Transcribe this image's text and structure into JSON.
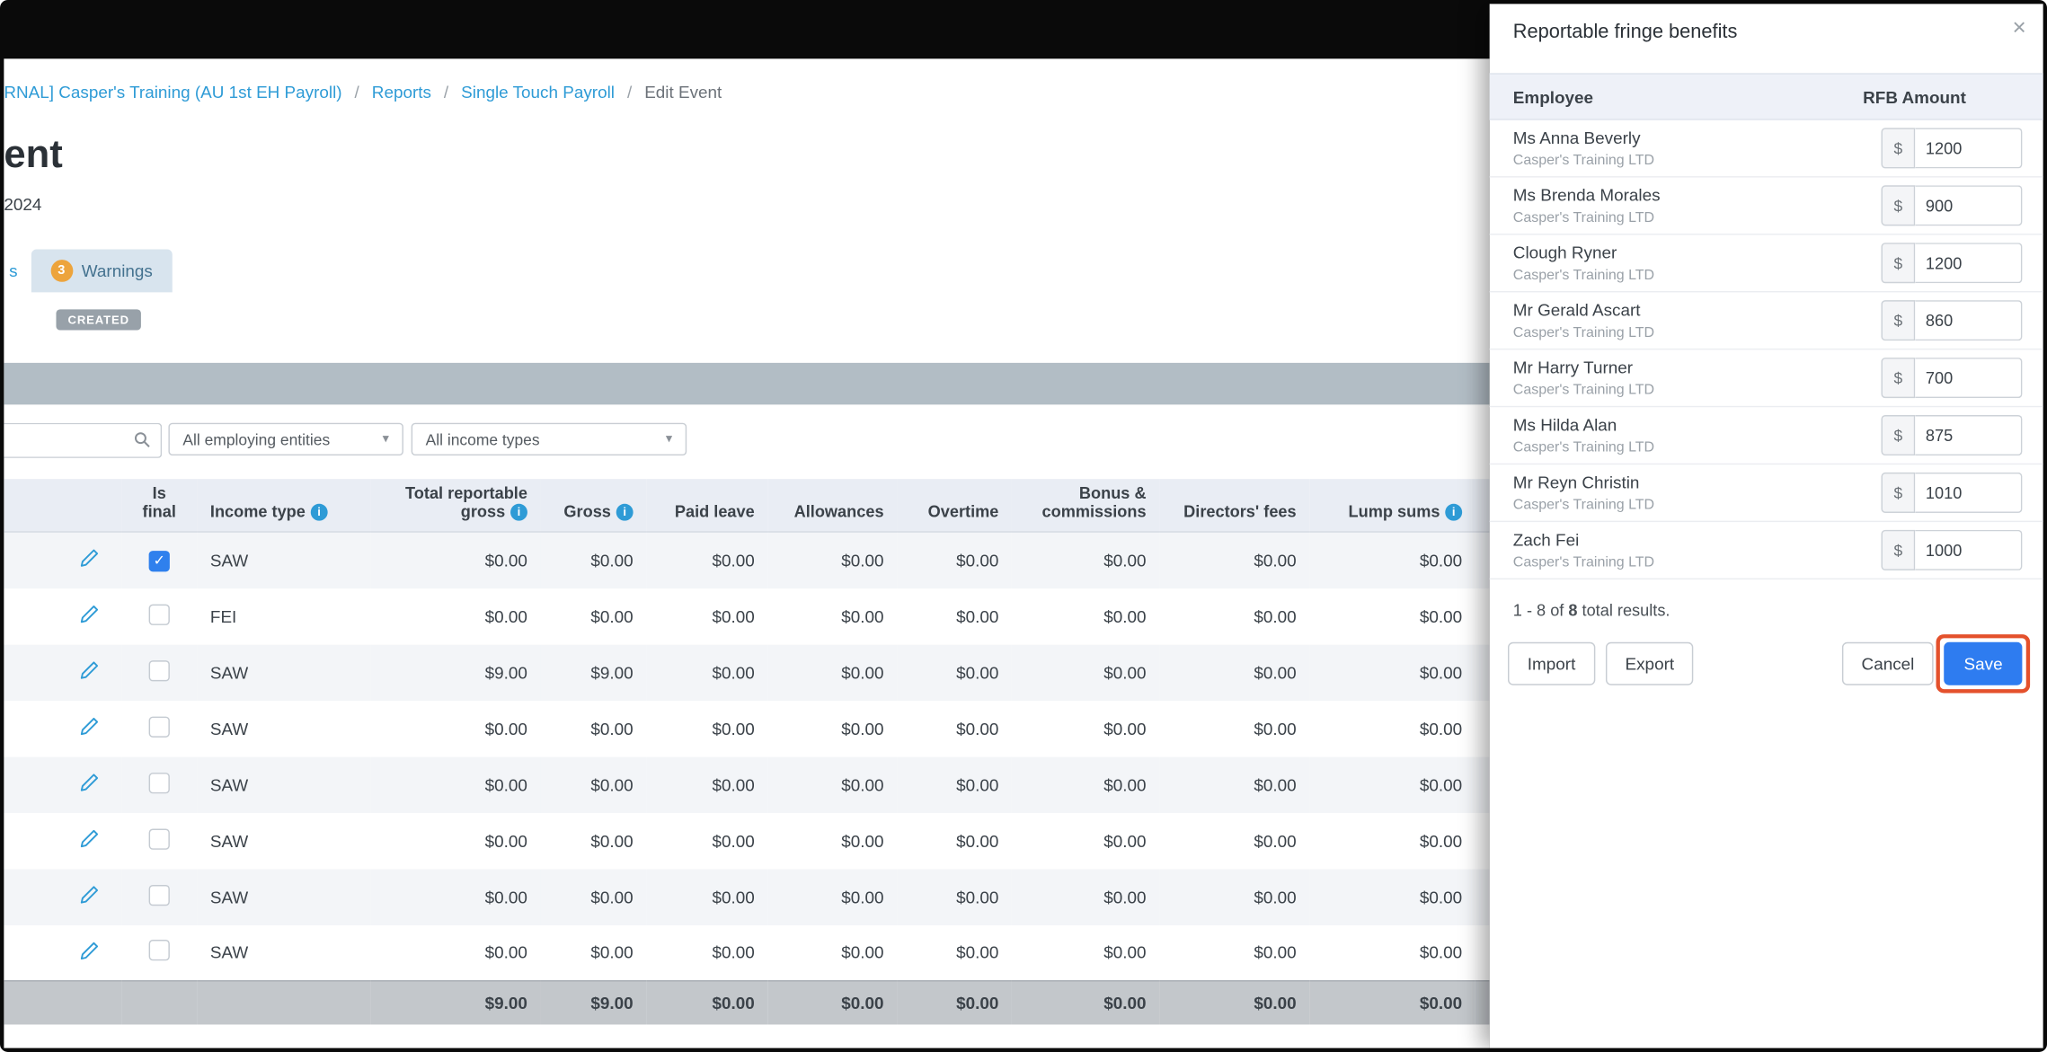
{
  "breadcrumb": {
    "items": [
      {
        "label": "RNAL] Casper's Training (AU 1st EH Payroll)"
      },
      {
        "label": "Reports"
      },
      {
        "label": "Single Touch Payroll"
      },
      {
        "label": "Edit Event"
      }
    ],
    "separator": "/"
  },
  "page": {
    "title_partial": "ent",
    "subtitle": "2024",
    "status_badge": "CREATED",
    "tabs": {
      "partial_tab": "s",
      "warnings_label": "Warnings",
      "warnings_count": "3"
    }
  },
  "filters": {
    "employing_entities": "All employing entities",
    "income_types": "All income types"
  },
  "table": {
    "headers": {
      "is_final": "Is final",
      "income_type": "Income type",
      "total_reportable_gross": "Total reportable gross",
      "gross": "Gross",
      "paid_leave": "Paid leave",
      "allowances": "Allowances",
      "overtime": "Overtime",
      "bonus_commissions": "Bonus & commissions",
      "directors_fees": "Directors' fees",
      "lump_sums": "Lump sums"
    },
    "rows": [
      {
        "income_type": "SAW",
        "is_final": true,
        "amounts": [
          "$0.00",
          "$0.00",
          "$0.00",
          "$0.00",
          "$0.00",
          "$0.00",
          "$0.00",
          "$0.00"
        ]
      },
      {
        "income_type": "FEI",
        "is_final": false,
        "amounts": [
          "$0.00",
          "$0.00",
          "$0.00",
          "$0.00",
          "$0.00",
          "$0.00",
          "$0.00",
          "$0.00"
        ]
      },
      {
        "income_type": "SAW",
        "is_final": false,
        "amounts": [
          "$9.00",
          "$9.00",
          "$0.00",
          "$0.00",
          "$0.00",
          "$0.00",
          "$0.00",
          "$0.00"
        ]
      },
      {
        "income_type": "SAW",
        "is_final": false,
        "amounts": [
          "$0.00",
          "$0.00",
          "$0.00",
          "$0.00",
          "$0.00",
          "$0.00",
          "$0.00",
          "$0.00"
        ]
      },
      {
        "income_type": "SAW",
        "is_final": false,
        "amounts": [
          "$0.00",
          "$0.00",
          "$0.00",
          "$0.00",
          "$0.00",
          "$0.00",
          "$0.00",
          "$0.00"
        ]
      },
      {
        "income_type": "SAW",
        "is_final": false,
        "amounts": [
          "$0.00",
          "$0.00",
          "$0.00",
          "$0.00",
          "$0.00",
          "$0.00",
          "$0.00",
          "$0.00"
        ]
      },
      {
        "income_type": "SAW",
        "is_final": false,
        "amounts": [
          "$0.00",
          "$0.00",
          "$0.00",
          "$0.00",
          "$0.00",
          "$0.00",
          "$0.00",
          "$0.00"
        ]
      },
      {
        "income_type": "SAW",
        "is_final": false,
        "amounts": [
          "$0.00",
          "$0.00",
          "$0.00",
          "$0.00",
          "$0.00",
          "$0.00",
          "$0.00",
          "$0.00"
        ]
      }
    ],
    "totals": [
      "$9.00",
      "$9.00",
      "$0.00",
      "$0.00",
      "$0.00",
      "$0.00",
      "$0.00",
      "$0.00"
    ]
  },
  "panel": {
    "title": "Reportable fringe benefits",
    "close": "×",
    "columns": {
      "employee": "Employee",
      "amount": "RFB Amount"
    },
    "currency": "$",
    "rows": [
      {
        "name": "Ms Anna Beverly",
        "company": "Casper's Training LTD",
        "amount": "1200"
      },
      {
        "name": "Ms Brenda Morales",
        "company": "Casper's Training LTD",
        "amount": "900"
      },
      {
        "name": "Clough Ryner",
        "company": "Casper's Training LTD",
        "amount": "1200"
      },
      {
        "name": "Mr Gerald Ascart",
        "company": "Casper's Training LTD",
        "amount": "860"
      },
      {
        "name": "Mr Harry Turner",
        "company": "Casper's Training LTD",
        "amount": "700"
      },
      {
        "name": "Ms Hilda Alan",
        "company": "Casper's Training LTD",
        "amount": "875"
      },
      {
        "name": "Mr Reyn Christin",
        "company": "Casper's Training LTD",
        "amount": "1010"
      },
      {
        "name": "Zach Fei",
        "company": "Casper's Training LTD",
        "amount": "1000"
      }
    ],
    "results": {
      "prefix": "1 - 8 of ",
      "total": "8",
      "suffix": " total results."
    },
    "buttons": {
      "import": "Import",
      "export": "Export",
      "cancel": "Cancel",
      "save": "Save"
    }
  }
}
